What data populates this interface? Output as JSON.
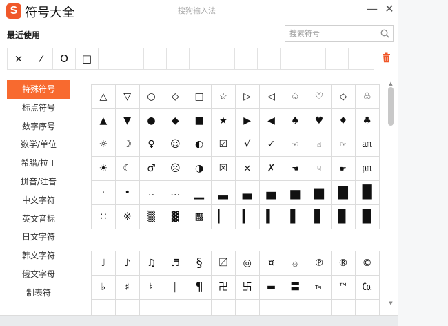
{
  "window": {
    "logo": "S",
    "title": "符号大全",
    "ime_name": "搜狗输入法",
    "minimize": "—",
    "close": "✕"
  },
  "recent": {
    "label": "最近使用",
    "symbols": [
      "×",
      "⁄",
      "O",
      "□",
      "",
      "",
      "",
      "",
      "",
      "",
      "",
      "",
      "",
      "",
      "",
      ""
    ]
  },
  "search": {
    "placeholder": "搜索符号"
  },
  "sidebar": {
    "items": [
      {
        "label": "特殊符号",
        "active": true
      },
      {
        "label": "标点符号"
      },
      {
        "label": "数字序号"
      },
      {
        "label": "数学/单位"
      },
      {
        "label": "希腊/拉丁"
      },
      {
        "label": "拼音/注音"
      },
      {
        "label": "中文字符"
      },
      {
        "label": "英文音标"
      },
      {
        "label": "日文字符"
      },
      {
        "label": "韩文字符"
      },
      {
        "label": "俄文字母"
      },
      {
        "label": "制表符"
      }
    ]
  },
  "grid1": [
    "△",
    "▽",
    "○",
    "◇",
    "□",
    "☆",
    "▷",
    "◁",
    "♤",
    "♡",
    "◇",
    "♧",
    "▲",
    "▼",
    "●",
    "◆",
    "■",
    "★",
    "▶",
    "◀",
    "♠",
    "♥",
    "♦",
    "♣",
    "☼",
    "☽",
    "♀",
    "☺",
    "◐",
    "☑",
    "√",
    "✓",
    "☜",
    "☝",
    "☞",
    "㏂",
    "☀",
    "☾",
    "♂",
    "☹",
    "◑",
    "☒",
    "×",
    "✗",
    "☚",
    "☟",
    "☛",
    "㏘",
    "·",
    "•",
    "‥",
    "…",
    "▁",
    "▂",
    "▃",
    "▄",
    "▅",
    "▆",
    "▇",
    "█",
    "∷",
    "※",
    "▒",
    "▓",
    "▩",
    "▏",
    "▎",
    "▍",
    "▌",
    "▋",
    "▊",
    "▉"
  ],
  "grid2": [
    "♩",
    "♪",
    "♫",
    "♬",
    "§",
    "〼",
    "◎",
    "¤",
    "۞",
    "℗",
    "®",
    "©",
    "♭",
    "♯",
    "♮",
    "‖",
    "¶",
    "卍",
    "卐",
    "▬",
    "〓",
    "℡",
    "™",
    "㏇",
    "",
    "",
    "",
    "",
    "",
    "",
    "",
    "",
    "",
    "",
    "",
    ""
  ],
  "colors": {
    "accent": "#f86a2f",
    "logo": "#f0582a",
    "trash": "#f0582a"
  },
  "icons": {
    "search": "search-icon",
    "trash": "trash-icon"
  }
}
